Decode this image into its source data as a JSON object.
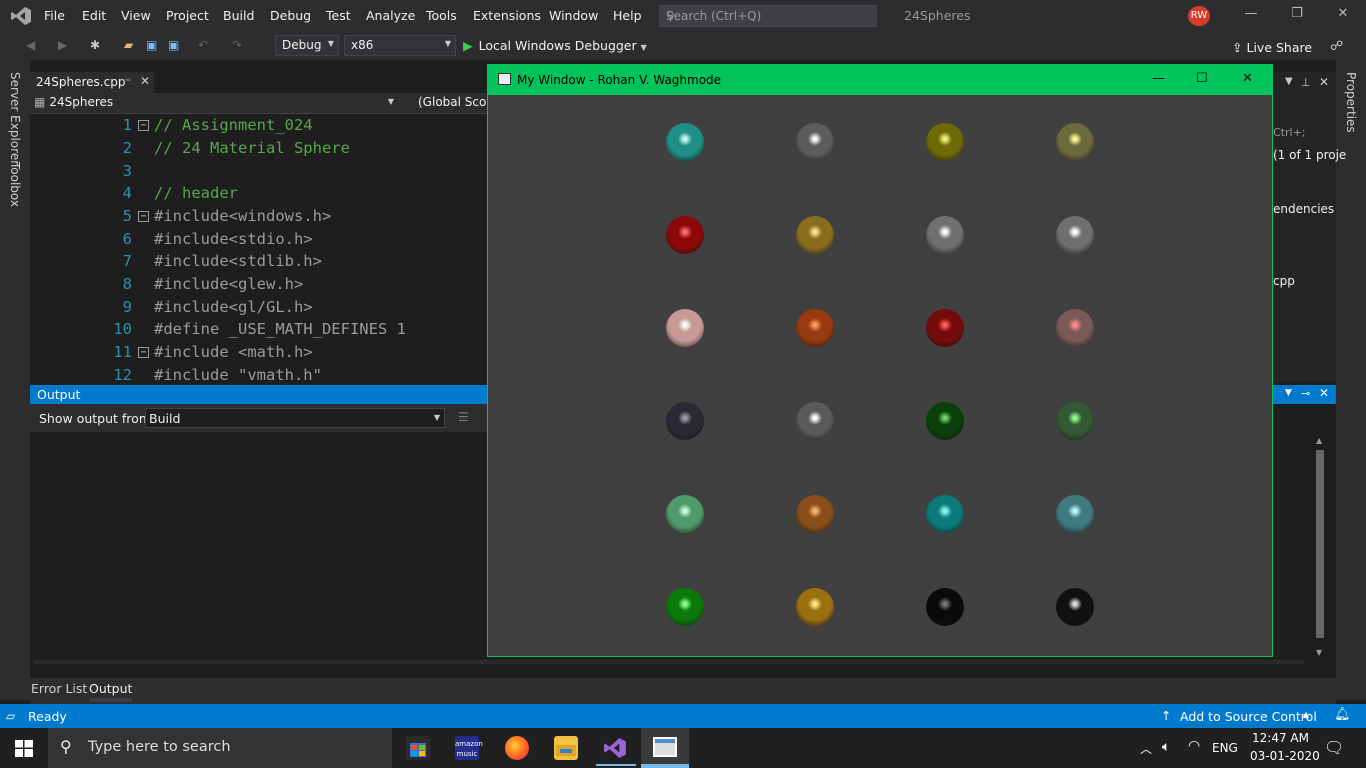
{
  "menubar": {
    "items": [
      "File",
      "Edit",
      "View",
      "Project",
      "Build",
      "Debug",
      "Test",
      "Analyze",
      "Tools",
      "Extensions",
      "Window",
      "Help"
    ],
    "search_placeholder": "Search (Ctrl+Q)",
    "solution_name": "24Spheres",
    "avatar_initials": "RW"
  },
  "toolbar": {
    "config": "Debug",
    "platform": "x86",
    "run_label": "Local Windows Debugger",
    "live_share": "Live Share"
  },
  "left_tabs": [
    "Server Explorer",
    "Toolbox"
  ],
  "right_tabs": [
    "Properties"
  ],
  "editor": {
    "tab_label": "24Spheres.cpp",
    "nav_project": "24Spheres",
    "nav_scope": "(Global Scope",
    "lines": [
      {
        "n": "1",
        "text": "// Assignment_024"
      },
      {
        "n": "2",
        "text": "// 24 Material Sphere"
      },
      {
        "n": "3",
        "text": ""
      },
      {
        "n": "4",
        "text": "// header"
      },
      {
        "n": "5",
        "text": "#include<windows.h>"
      },
      {
        "n": "6",
        "text": "#include<stdio.h>"
      },
      {
        "n": "7",
        "text": "#include<stdlib.h>"
      },
      {
        "n": "8",
        "text": "#include<glew.h>"
      },
      {
        "n": "9",
        "text": "#include<gl/GL.h>"
      },
      {
        "n": "10",
        "text": "#define _USE_MATH_DEFINES 1"
      },
      {
        "n": "11",
        "text": "#include <math.h>"
      },
      {
        "n": "12",
        "text": "#include \"vmath.h\""
      }
    ]
  },
  "solution_peek": {
    "search_hint": "Ctrl+;",
    "count": "(1 of 1 proje",
    "item1": "endencies",
    "item2": "cpp"
  },
  "output": {
    "title": "Output",
    "show_from_label": "Show output from:",
    "show_from_value": "Build"
  },
  "bottom_tabs": [
    "Error List",
    "Output"
  ],
  "gl_window": {
    "title": "My Window - Rohan V. Waghmode",
    "spheres": [
      {
        "base": "#1f8f88",
        "hi": "#c8f7f3"
      },
      {
        "base": "#5c5c5c",
        "hi": "#ffffff"
      },
      {
        "base": "#6e6a06",
        "hi": "#f4f07a"
      },
      {
        "base": "#6b6a3c",
        "hi": "#fff78a"
      },
      {
        "base": "#8d0909",
        "hi": "#ff6a6a"
      },
      {
        "base": "#8a6d1c",
        "hi": "#ffe38a"
      },
      {
        "base": "#707070",
        "hi": "#ffffff"
      },
      {
        "base": "#6f6f6f",
        "hi": "#ffffff"
      },
      {
        "base": "#c79a96",
        "hi": "#ffffff"
      },
      {
        "base": "#9a3a0f",
        "hi": "#ff9a5a"
      },
      {
        "base": "#760b0b",
        "hi": "#ff5a5a"
      },
      {
        "base": "#7a5a57",
        "hi": "#ff8a8a"
      },
      {
        "base": "#2a2a33",
        "hi": "#9a9aaa"
      },
      {
        "base": "#5a5a5a",
        "hi": "#ffffff"
      },
      {
        "base": "#0a400a",
        "hi": "#6ad46a"
      },
      {
        "base": "#345a34",
        "hi": "#8aff8a"
      },
      {
        "base": "#4f9a6a",
        "hi": "#ccffdd"
      },
      {
        "base": "#8a4e1a",
        "hi": "#ffae6a"
      },
      {
        "base": "#0a7a7a",
        "hi": "#8af4f4"
      },
      {
        "base": "#3f7a7f",
        "hi": "#bff8ff"
      },
      {
        "base": "#0a7a0a",
        "hi": "#8aff8a"
      },
      {
        "base": "#9a7010",
        "hi": "#ffe88a"
      },
      {
        "base": "#0a0a0a",
        "hi": "#777777"
      },
      {
        "base": "#111111",
        "hi": "#dddddd"
      }
    ]
  },
  "statusbar": {
    "ready": "Ready",
    "source_control": "Add to Source Control"
  },
  "taskbar": {
    "search_placeholder": "Type here to search",
    "language": "ENG",
    "time": "12:47 AM",
    "date": "03-01-2020"
  },
  "colors": {
    "accent": "#007acc",
    "gl_title": "#00c35c",
    "vs_purple": "#68217a"
  }
}
